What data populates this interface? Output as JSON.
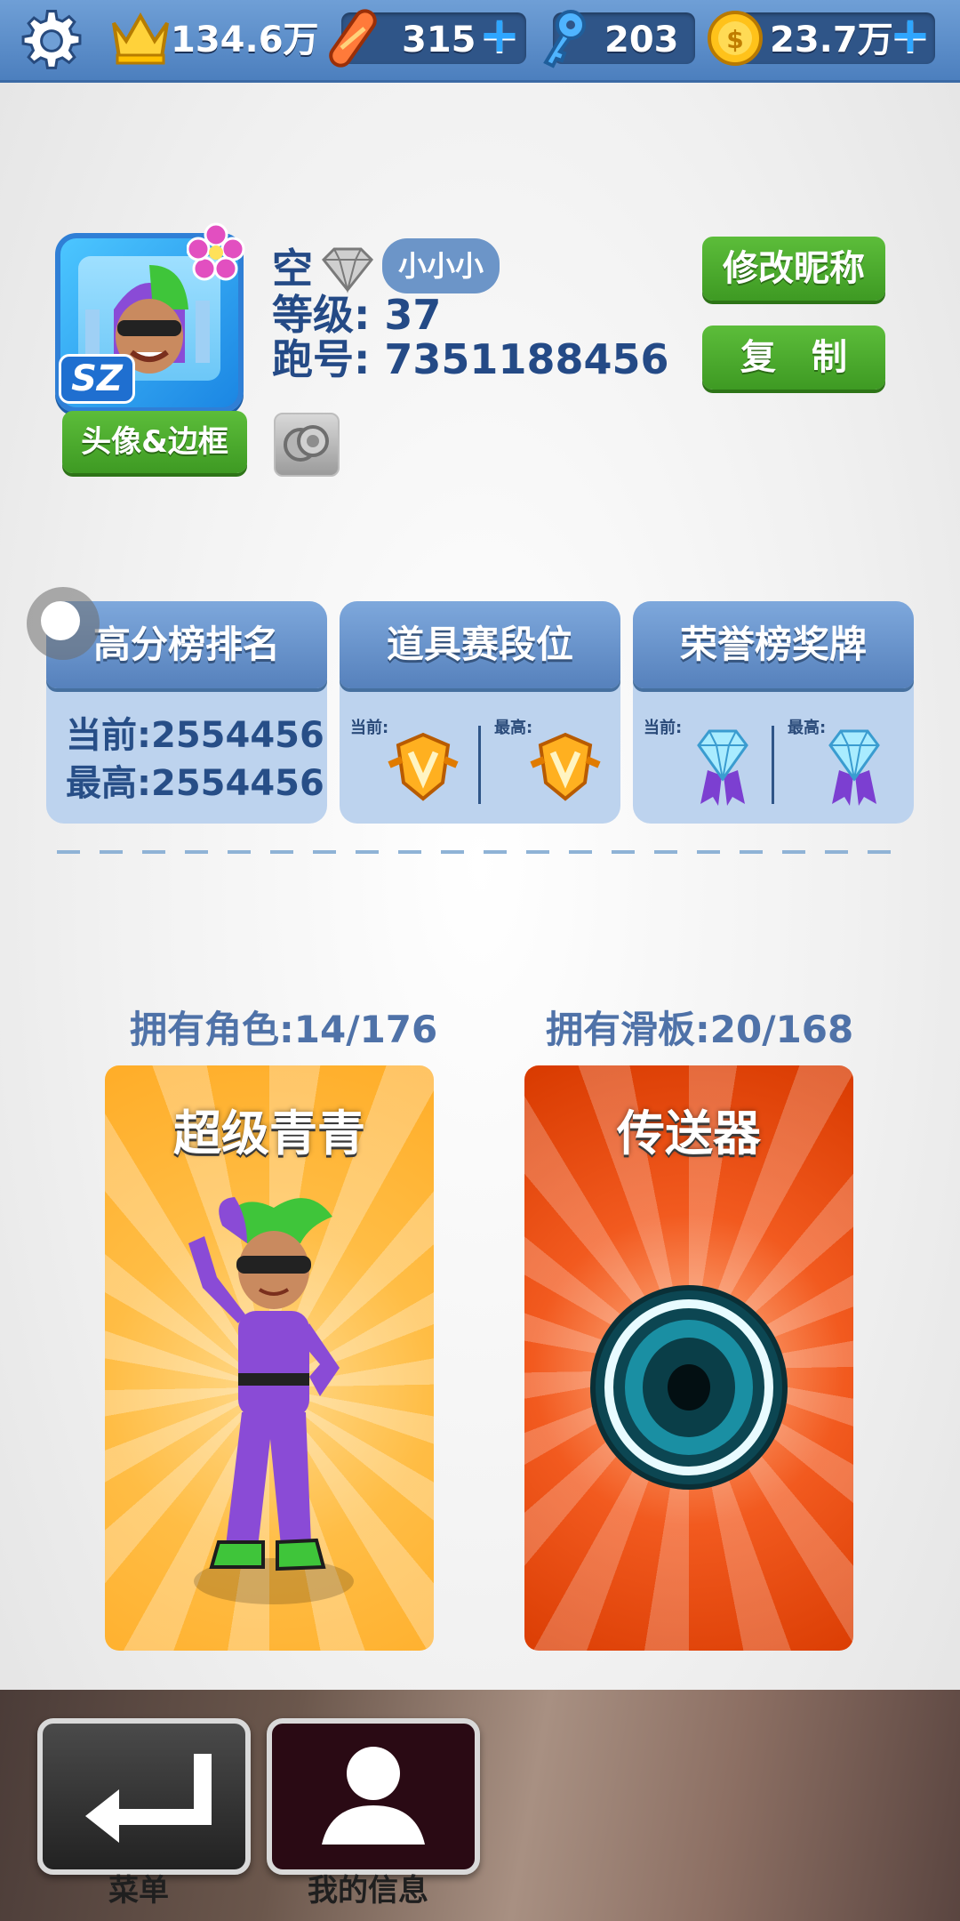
{
  "topbar": {
    "crowns": "134.6万",
    "boards": "315",
    "keys": "203",
    "coins": "23.7万",
    "plus": "+"
  },
  "profile": {
    "name": "空",
    "name_tag": "小小小",
    "level": "等级: 37",
    "runner_id": "跑号: 7351188456",
    "avatar_badge": "SZ",
    "edit_nickname": "修改昵称",
    "copy": "复　制",
    "avatar_frame_button": "头像&边框"
  },
  "cards": [
    {
      "title": "高分榜排名",
      "current": "当前:2554456",
      "best": "最高:2554456"
    },
    {
      "title": "道具赛段位",
      "current_label": "当前:",
      "best_label": "最高:"
    },
    {
      "title": "荣誉榜奖牌",
      "current_label": "当前:",
      "best_label": "最高:"
    }
  ],
  "owned": {
    "characters_label": "拥有角色:14/176",
    "boards_label": "拥有滑板:20/168",
    "character_name": "超级青青",
    "board_name": "传送器"
  },
  "nav": {
    "menu": "菜单",
    "my_info": "我的信息"
  },
  "colors": {
    "topbar": "#5a8ccb",
    "green_button": "#4aa82c",
    "card_head": "#6a94cc",
    "text_blue": "#244a86"
  }
}
